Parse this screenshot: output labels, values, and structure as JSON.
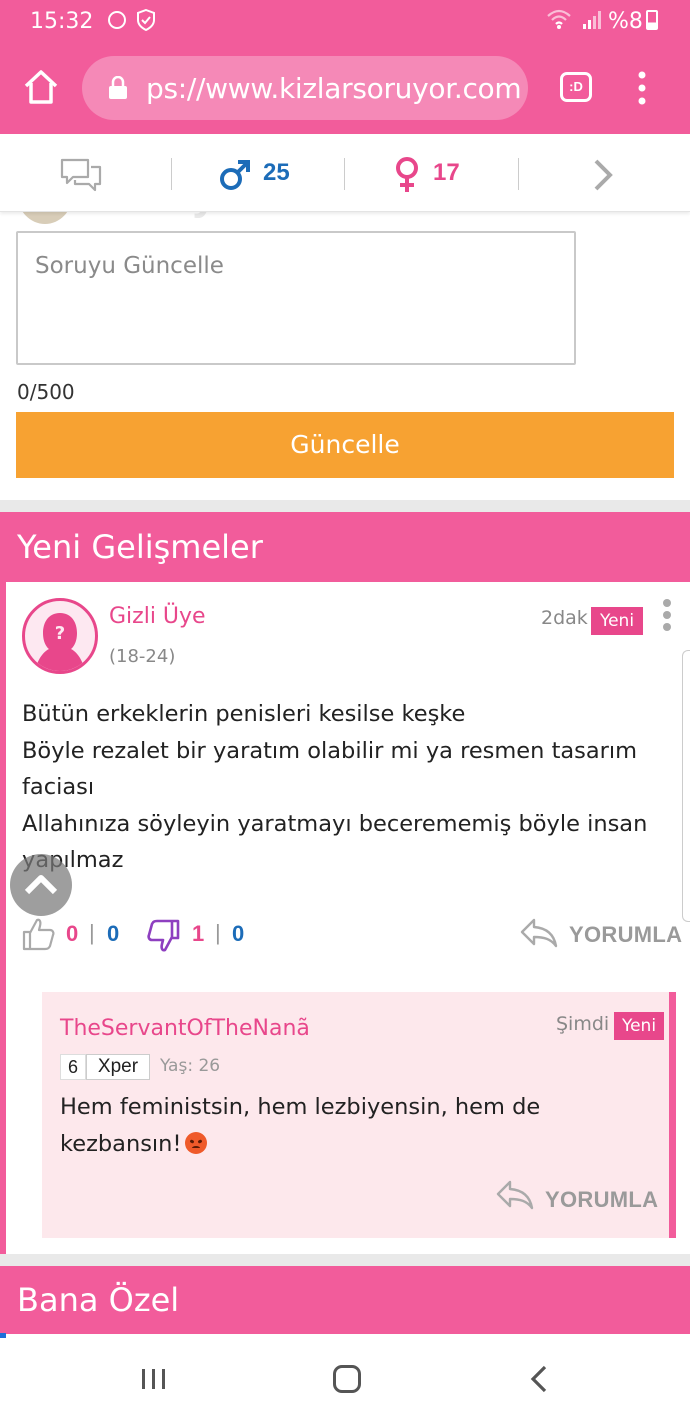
{
  "status_bar": {
    "time": "15:32",
    "battery": "%8"
  },
  "browser": {
    "url": "ps://www.kizlarsoruyor.com",
    "tab_label": ":D"
  },
  "stats": {
    "male_count": "25",
    "female_count": "17"
  },
  "update_form": {
    "header_title": "Soruyu Güncelle",
    "placeholder": "Soruyu Güncelle",
    "counter": "0/500",
    "button_label": "Güncelle"
  },
  "developments": {
    "title": "Yeni Gelişmeler",
    "post": {
      "author": "Gizli Üye",
      "age_range": "(18-24)",
      "time": "2dak",
      "badge": "Yeni",
      "body": "Bütün erkeklerin penisleri kesilse keşke\nBöyle rezalet bir yaratım olabilir mi ya resmen tasarım faciası\nAllahınıza söyleyin yaratmayı becerememiş böyle insan yapılmaz",
      "likes_female": "0",
      "likes_male": "0",
      "dislikes_female": "1",
      "dislikes_male": "0",
      "reply_label": "YORUMLA"
    },
    "reply": {
      "author": "TheServantOfTheNanã",
      "time": "Şimdi",
      "badge": "Yeni",
      "xper_level": "6",
      "xper_label": "Xper",
      "age": "Yaş: 26",
      "body": "Hem feministsin, hem lezbiyensin, hem de kezbansın!",
      "reply_label": "YORUMLA"
    }
  },
  "special": {
    "title": "Bana Özel"
  },
  "colors": {
    "brand_pink": "#f25c9b",
    "accent_orange": "#f7a232",
    "male_blue": "#1c6cb8",
    "female_pink": "#e8478b",
    "dislike_purple": "#8e3fc0"
  }
}
